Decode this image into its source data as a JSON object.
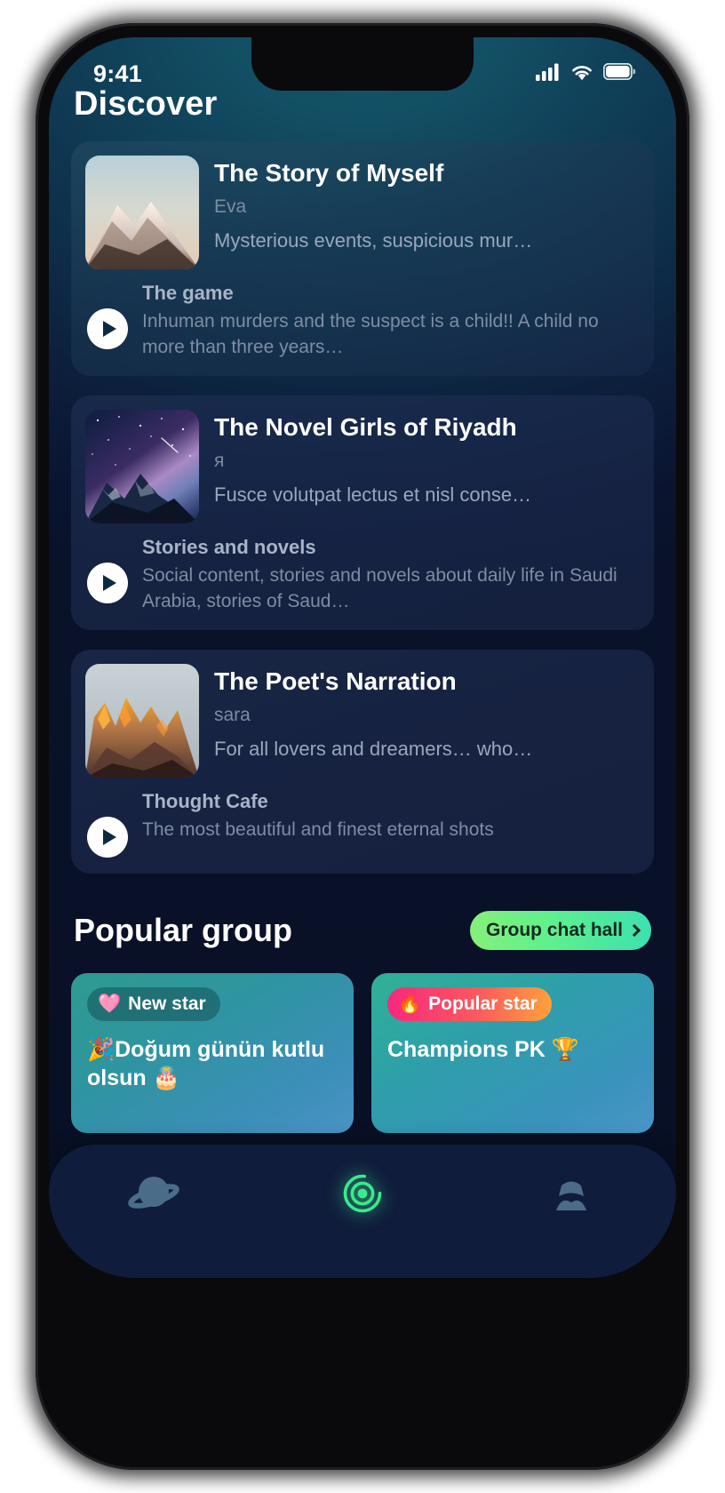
{
  "status_bar": {
    "time": "9:41",
    "icons": [
      "cellular-signal-icon",
      "wifi-icon",
      "battery-icon"
    ]
  },
  "header": {
    "title": "Discover"
  },
  "discover": {
    "cards": [
      {
        "title": "The Story of Myself",
        "author": "Eva",
        "description": "Mysterious events, suspicious mur…",
        "thumbnail_alt": "snow-capped-mountain-at-dawn",
        "play_label": "play-icon",
        "sub_title": "The game",
        "sub_description": "Inhuman murders and the suspect is a child!! A child no more than three years…"
      },
      {
        "title": "The Novel Girls of Riyadh",
        "author": "я",
        "description": "Fusce volutpat lectus et nisl conse…",
        "thumbnail_alt": "starry-night-sky-over-mountains",
        "play_label": "play-icon",
        "sub_title": "Stories and novels",
        "sub_description": "Social content, stories and novels about daily life in Saudi Arabia, stories of Saud…"
      },
      {
        "title": "The Poet's Narration",
        "author": "sara",
        "description": "For all lovers and dreamers… who…",
        "thumbnail_alt": "golden-lit-rocky-peaks",
        "play_label": "play-icon",
        "sub_title": "Thought Cafe",
        "sub_description": "The most beautiful and finest eternal shots"
      }
    ]
  },
  "popular_group": {
    "title": "Popular group",
    "action_label": "Group chat hall",
    "action_icon": "chevron-right-icon",
    "cards": [
      {
        "badge_emoji": "🩷",
        "badge_label": "New star",
        "badge_style": "new",
        "text": "🎉Doğum günün kutlu olsun 🎂"
      },
      {
        "badge_emoji": "🔥",
        "badge_label": "Popular star",
        "badge_style": "hot",
        "text": "Champions PK 🏆"
      }
    ]
  },
  "tabbar": {
    "items": [
      {
        "icon": "planet-icon",
        "active": false
      },
      {
        "icon": "broadcast-radar-icon",
        "active": true
      },
      {
        "icon": "person-bust-icon",
        "active": false
      }
    ]
  },
  "colors": {
    "accent_green": "#3de0b0",
    "accent_green_light": "#86f07a",
    "background_top": "#15566a",
    "background_bottom": "#080f24",
    "tabbar": "#0f1c3b",
    "badge_hot_start": "#f7267f",
    "badge_hot_end": "#ffa23a"
  }
}
